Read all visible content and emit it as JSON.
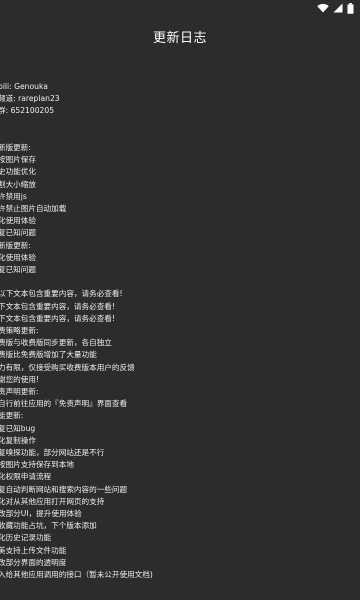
{
  "appbar": {
    "title": "更新日志"
  },
  "status": {
    "icons": [
      "wifi-icon",
      "signal-icon",
      "battery-icon"
    ]
  },
  "lines": [
    "bili: Genouka",
    "频道: rareplan23",
    "群: 652100205",
    "",
    "",
    "新版更新:",
    "按图片保存",
    "史功能优化",
    "割大小缩放",
    "许禁用js",
    "许禁止图片自动加载",
    "化使用体验",
    "复已知问题",
    "新版更新:",
    "化使用体验",
    "复已知问题",
    "",
    "以下文本包含重要内容，请务必查看!",
    "下文本包含重要内容，请务必查看!",
    "下文本包含重要内容，请务必查看!",
    "费策略更新:",
    "费版与收费版同步更新，各自独立",
    "费版比免费版增加了大量功能",
    "力有限，仅接受购买收费版本用户的反馈",
    "谢您的使用!",
    "责声明更新:",
    "自行前往应用的『免责声明』界面查看",
    "能更新:",
    "复已知bug",
    "化复制操作",
    "复嗅探功能，部分网站还是不行",
    "按图片支持保存到本地",
    "化权限申请流程",
    "复自动判断网站和搜索内容的一些问题",
    "化对从其他应用打开网页的支持",
    "改部分UI，提升使用体验",
    "收藏功能占坑，下个版本添加",
    "化历史记录功能",
    "美支持上传文件功能",
    "改部分界面的透明度",
    "入给其他应用调用的接口（暂未公开使用文档)"
  ]
}
